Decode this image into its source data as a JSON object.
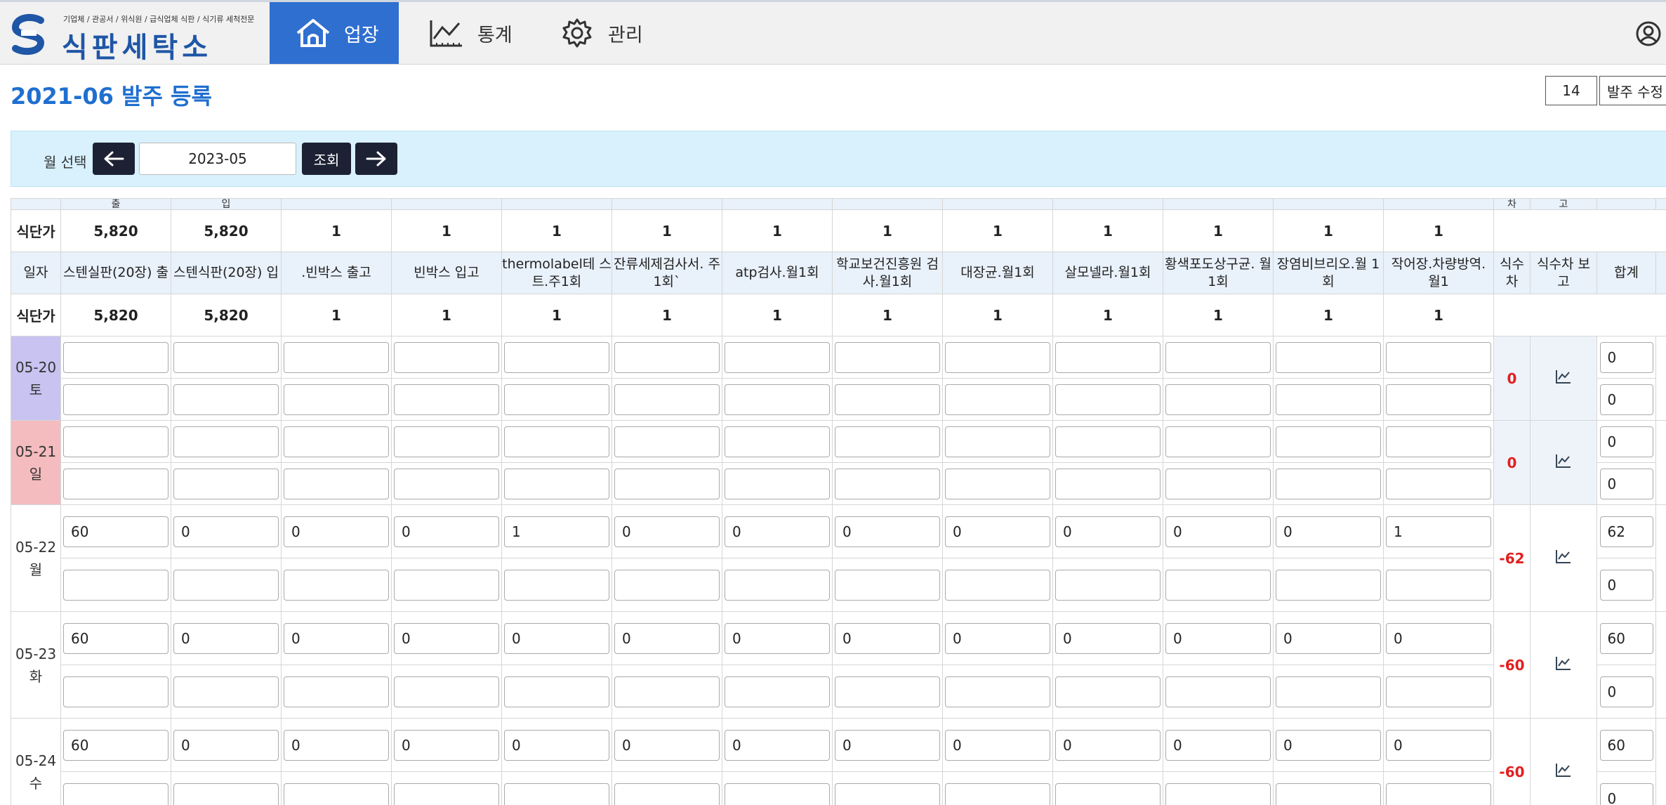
{
  "header": {
    "logo_tagline": "기업체 / 관공서 / 위식원 / 급식업체 식판 / 식기류 세척전문",
    "logo_name": "식판세탁소",
    "nav": [
      {
        "label": "업장",
        "icon": "home-icon",
        "active": true
      },
      {
        "label": "통계",
        "icon": "line-chart-icon",
        "active": false
      },
      {
        "label": "관리",
        "icon": "gear-icon",
        "active": false
      }
    ],
    "user_icon": "user-circle-icon"
  },
  "page": {
    "title": "2021-06 발주 등록",
    "count_value": "14",
    "order_edit_label": "발주 수정"
  },
  "month_selector": {
    "label": "월 선택",
    "value": "2023-05",
    "query_label": "조회"
  },
  "grid": {
    "cut_header": [
      "",
      "출",
      "입",
      "",
      "",
      "",
      "",
      "",
      "",
      "",
      "",
      "",
      "",
      "",
      "차",
      "고",
      ""
    ],
    "price_label": "식단가",
    "prices": [
      "5,820",
      "5,820",
      "1",
      "1",
      "1",
      "1",
      "1",
      "1",
      "1",
      "1",
      "1",
      "1",
      "1"
    ],
    "date_header": "일자",
    "columns": [
      "스텐실판(20장) 출",
      "스텐식판(20장) 입",
      ".빈박스 출고",
      "빈박스 입고",
      "thermolabel테 스트.주1회",
      "잔류세제검사서. 주1회`",
      "atp검사.월1회",
      "학교보건진흥원 검사.월1회",
      "대장균.월1회",
      "살모넬라.월1회",
      "황색포도상구균. 월1회",
      "장염비브리오.월 1회",
      "작어장.차량방역. 월1"
    ],
    "diff_header": "식수 차",
    "report_header": "식수차 보 고",
    "total_header": "합계",
    "rows": [
      {
        "date": "05-20",
        "day": "토",
        "kind": "sat",
        "values": [
          "",
          "",
          "",
          "",
          "",
          "",
          "",
          "",
          "",
          "",
          "",
          "",
          ""
        ],
        "diff": "0",
        "total_top": "0",
        "total_bottom": "0"
      },
      {
        "date": "05-21",
        "day": "일",
        "kind": "sun",
        "values": [
          "",
          "",
          "",
          "",
          "",
          "",
          "",
          "",
          "",
          "",
          "",
          "",
          ""
        ],
        "diff": "0",
        "total_top": "0",
        "total_bottom": "0"
      },
      {
        "date": "05-22",
        "day": "월",
        "kind": "norm",
        "values": [
          "60",
          "0",
          "0",
          "0",
          "1",
          "0",
          "0",
          "0",
          "0",
          "0",
          "0",
          "0",
          "1"
        ],
        "diff": "-62",
        "total_top": "62",
        "total_bottom": "0"
      },
      {
        "date": "05-23",
        "day": "화",
        "kind": "norm",
        "values": [
          "60",
          "0",
          "0",
          "0",
          "0",
          "0",
          "0",
          "0",
          "0",
          "0",
          "0",
          "0",
          "0"
        ],
        "diff": "-60",
        "total_top": "60",
        "total_bottom": "0"
      },
      {
        "date": "05-24",
        "day": "수",
        "kind": "norm",
        "values": [
          "60",
          "0",
          "0",
          "0",
          "0",
          "0",
          "0",
          "0",
          "0",
          "0",
          "0",
          "0",
          "0"
        ],
        "diff": "-60",
        "total_top": "60",
        "total_bottom": "0"
      }
    ]
  }
}
